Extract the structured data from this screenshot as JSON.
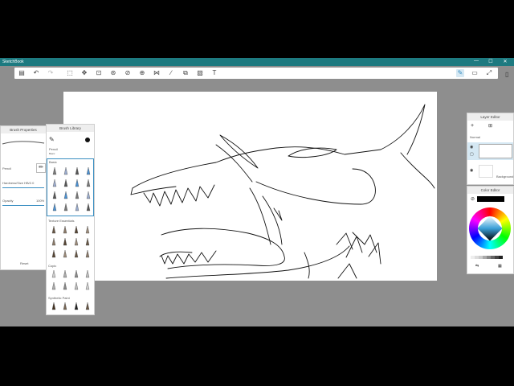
{
  "app": {
    "title": "SketchBook"
  },
  "window_controls": {
    "minimize": "—",
    "maximize": "☐",
    "close": "✕"
  },
  "brush_properties": {
    "title": "Brush Properties",
    "brush_name": "Pencil",
    "hardness_label": "Hardness/Size HB/2.0",
    "hardness_value": "2.0",
    "opacity_label": "Opacity",
    "opacity_value": "100%",
    "reset_label": "Reset"
  },
  "brush_library": {
    "title": "Brush Library",
    "current_brush": "Pencil",
    "current_brush_sub": "Basic",
    "sections": [
      "Basic",
      "Texture Essentials",
      "Copic",
      "Synthetic Paint"
    ]
  },
  "layer_editor": {
    "title": "Layer Editor",
    "blend_mode": "Normal",
    "background_label": "Background"
  },
  "color_editor": {
    "title": "Color Editor",
    "current_color": "#000000"
  },
  "colors": {
    "titlebar": "#1d7a80",
    "accent": "#3a8fc2",
    "app_bg": "#8e8e8e"
  }
}
